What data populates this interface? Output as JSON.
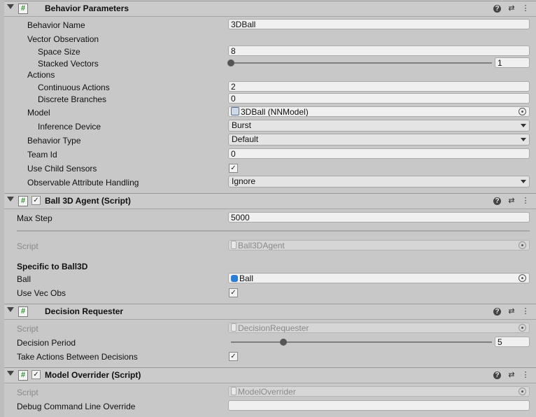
{
  "behavior_parameters": {
    "title": "Behavior Parameters",
    "enabled_check": "",
    "behavior_name_label": "Behavior Name",
    "behavior_name_value": "3DBall",
    "vector_observation_label": "Vector Observation",
    "space_size_label": "Space Size",
    "space_size_value": "8",
    "stacked_vectors_label": "Stacked Vectors",
    "stacked_vectors_value": "1",
    "stacked_vectors_slider_fraction": 0.0,
    "actions_label": "Actions",
    "continuous_actions_label": "Continuous Actions",
    "continuous_actions_value": "2",
    "discrete_branches_label": "Discrete Branches",
    "discrete_branches_value": "0",
    "model_label": "Model",
    "model_value": "3DBall (NNModel)",
    "inference_device_label": "Inference Device",
    "inference_device_value": "Burst",
    "behavior_type_label": "Behavior Type",
    "behavior_type_value": "Default",
    "team_id_label": "Team Id",
    "team_id_value": "0",
    "use_child_sensors_label": "Use Child Sensors",
    "use_child_sensors_check": "✓",
    "observable_label": "Observable Attribute Handling",
    "observable_value": "Ignore"
  },
  "ball_agent": {
    "title": "Ball 3D Agent (Script)",
    "enabled_check": "✓",
    "max_step_label": "Max Step",
    "max_step_value": "5000",
    "script_label": "Script",
    "script_value": "Ball3DAgent",
    "specific_label": "Specific to Ball3D",
    "ball_label": "Ball",
    "ball_value": "Ball",
    "use_vec_obs_label": "Use Vec Obs",
    "use_vec_obs_check": "✓"
  },
  "decision_requester": {
    "title": "Decision Requester",
    "script_label": "Script",
    "script_value": "DecisionRequester",
    "decision_period_label": "Decision Period",
    "decision_period_value": "5",
    "decision_period_slider_fraction": 0.2,
    "take_actions_label": "Take Actions Between Decisions",
    "take_actions_check": "✓"
  },
  "model_overrider": {
    "title": "Model Overrider (Script)",
    "enabled_check": "✓",
    "script_label": "Script",
    "script_value": "ModelOverrider",
    "debug_label": "Debug Command Line Override",
    "debug_value": ""
  },
  "icons": {
    "hash": "#",
    "help": "?",
    "settings": "⇄",
    "more": "⋮"
  },
  "colors": {
    "background": "#c8c8c8",
    "script_green": "#2f8f2f",
    "ball_blue": "#2a7fd4"
  }
}
